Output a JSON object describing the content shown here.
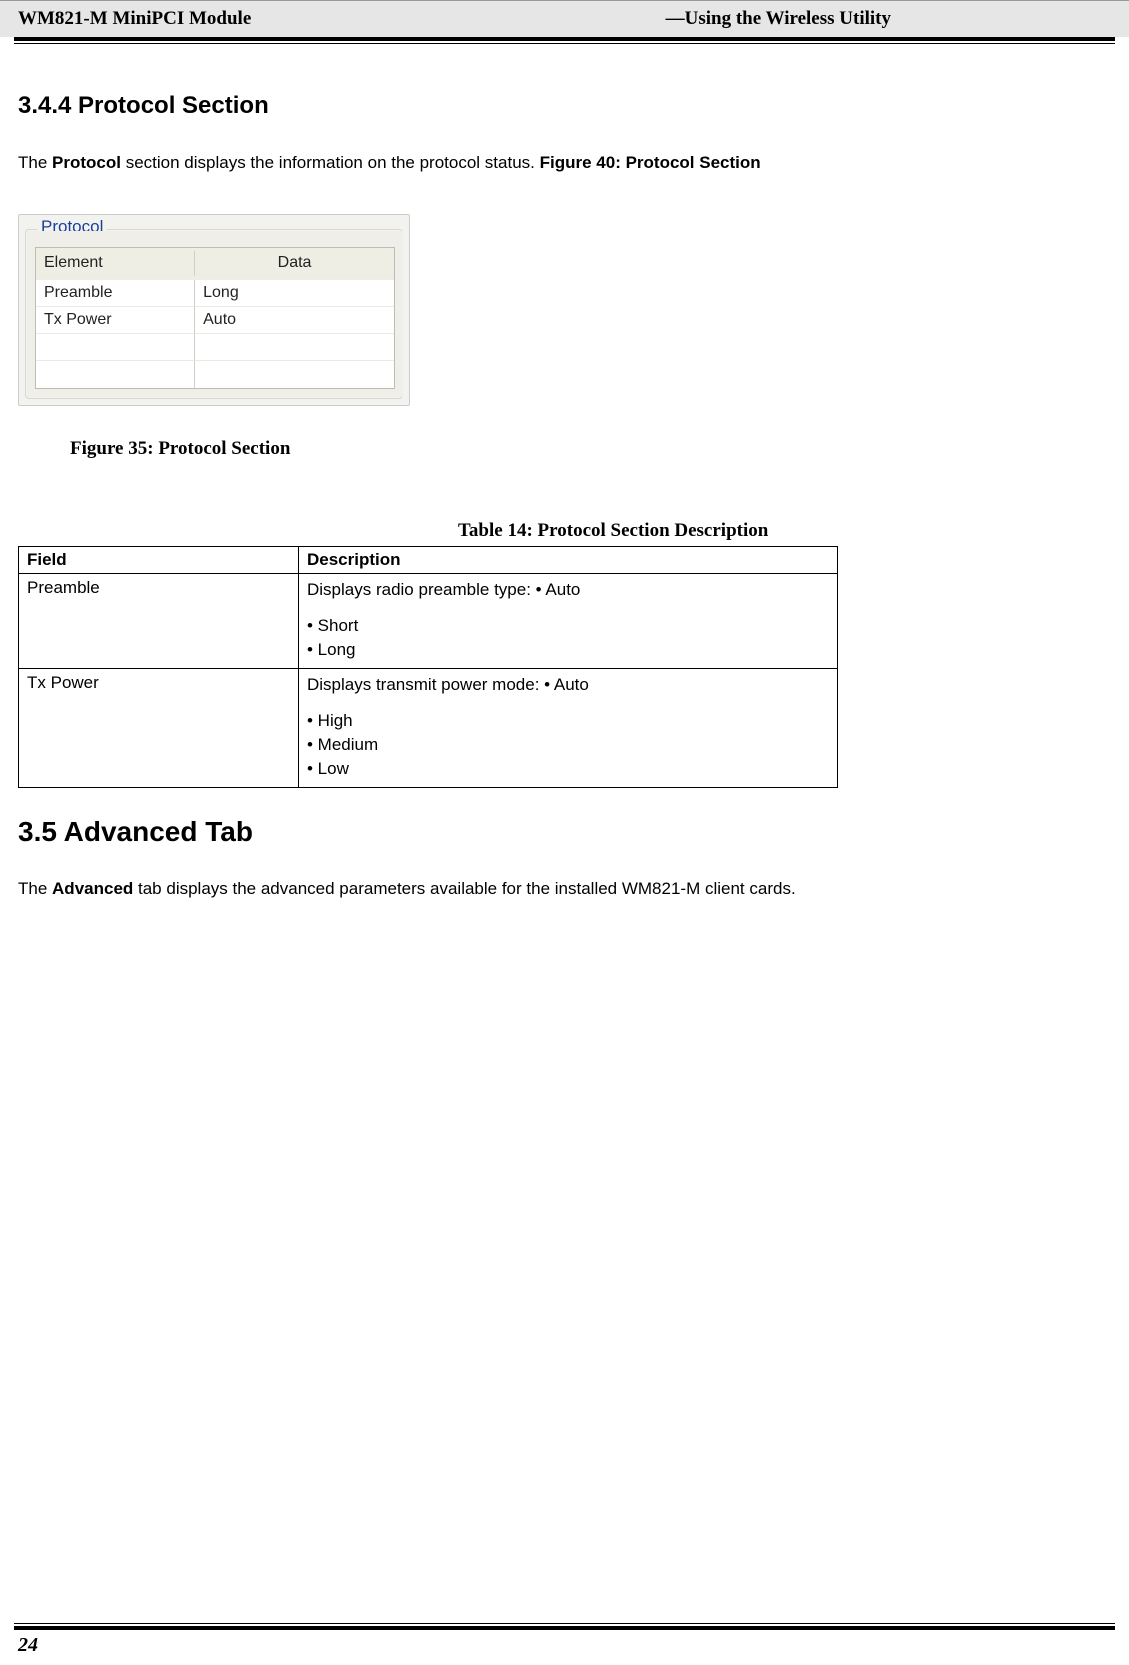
{
  "header": {
    "left": "WM821-M MiniPCI Module",
    "right": "—Using the Wireless Utility"
  },
  "section_3_4_4": {
    "heading": "3.4.4 Protocol Section",
    "intro_pre": "The ",
    "intro_bold": "Protocol",
    "intro_mid": " section displays the information on the protocol status. ",
    "intro_ref": "Figure 40: Protocol Section"
  },
  "proto_shot": {
    "legend": "Protocol",
    "head_element": "Element",
    "head_data": "Data",
    "rows": [
      {
        "element": "Preamble",
        "data": "Long"
      },
      {
        "element": "Tx Power",
        "data": "Auto"
      },
      {
        "element": "",
        "data": ""
      },
      {
        "element": "",
        "data": ""
      }
    ]
  },
  "figure_caption": {
    "label": "Figure 35:",
    "text": " Protocol Section"
  },
  "table_caption": {
    "label": "Table 14:",
    "text": " Protocol Section Description"
  },
  "desc_table": {
    "head_field": "Field",
    "head_desc": "Description",
    "rows": [
      {
        "field": "Preamble",
        "first": "Displays radio preamble type: • Auto",
        "bullets": [
          "• Short",
          "• Long"
        ]
      },
      {
        "field": "Tx Power",
        "first": "Displays transmit power mode: • Auto",
        "bullets": [
          "• High",
          "• Medium",
          "• Low"
        ]
      }
    ]
  },
  "section_3_5": {
    "heading": "3.5 Advanced Tab",
    "para_pre": "The ",
    "para_bold": "Advanced",
    "para_post": " tab displays the advanced parameters available for the installed WM821-M client cards."
  },
  "footer": {
    "page_number": "24"
  }
}
